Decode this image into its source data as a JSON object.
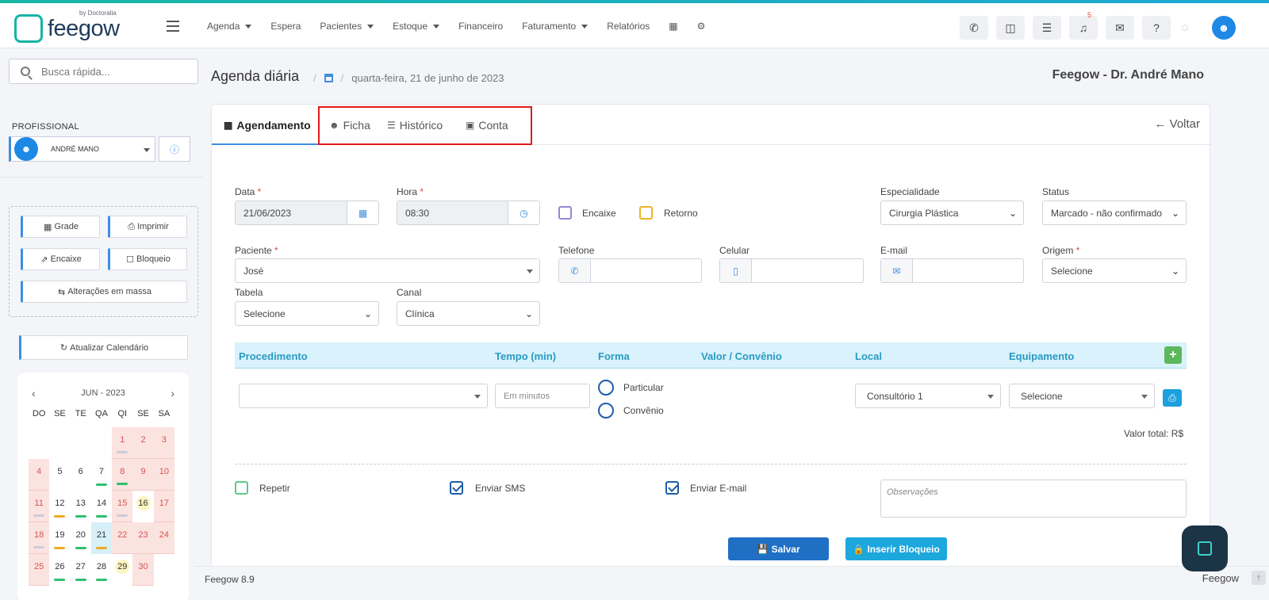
{
  "brand": {
    "name": "feegow",
    "by": "by Doctoralia",
    "accent": "#16b4a5"
  },
  "nav": [
    {
      "label": "Agenda",
      "dropdown": true
    },
    {
      "label": "Espera",
      "dropdown": false
    },
    {
      "label": "Pacientes",
      "dropdown": true
    },
    {
      "label": "Estoque",
      "dropdown": true
    },
    {
      "label": "Financeiro",
      "dropdown": false
    },
    {
      "label": "Faturamento",
      "dropdown": true
    },
    {
      "label": "Relatórios",
      "dropdown": false
    }
  ],
  "topbar": {
    "notifications_count": "5"
  },
  "sidebar": {
    "search_placeholder": "Busca rápida...",
    "profissional_label": "PROFISSIONAL",
    "profissional_name": "ANDRÉ MANO",
    "buttons": {
      "grade": "Grade",
      "imprimir": "Imprimir",
      "encaixe": "Encaixe",
      "bloqueio": "Bloqueio",
      "alteracoes": "Alterações em massa"
    },
    "atualizar": "Atualizar Calendário",
    "calendar": {
      "month": "JUN - 2023",
      "weekdays": [
        "DO",
        "SE",
        "TE",
        "QA",
        "QI",
        "SE",
        "SA"
      ],
      "weeks": [
        [
          "",
          "",
          "",
          "",
          "1",
          "2",
          "3"
        ],
        [
          "4",
          "5",
          "6",
          "7",
          "8",
          "9",
          "10"
        ],
        [
          "11",
          "12",
          "13",
          "14",
          "15",
          "16",
          "17"
        ],
        [
          "18",
          "19",
          "20",
          "21",
          "22",
          "23",
          "24"
        ],
        [
          "25",
          "26",
          "27",
          "28",
          "29",
          "30",
          ""
        ]
      ]
    }
  },
  "page": {
    "title": "Agenda diária",
    "date": "quarta-feira, 21 de junho de 2023",
    "doctor": "Feegow - Dr. André Mano"
  },
  "tabs": {
    "agendamento": "Agendamento",
    "ficha": "Ficha",
    "historico": "Histórico",
    "conta": "Conta",
    "voltar": "Voltar"
  },
  "form": {
    "data_label": "Data",
    "data_value": "21/06/2023",
    "hora_label": "Hora",
    "hora_value": "08:30",
    "encaixe": "Encaixe",
    "retorno": "Retorno",
    "especialidade_label": "Especialidade",
    "especialidade_value": "Cirurgia Plástica",
    "status_label": "Status",
    "status_value": "Marcado - não confirmado",
    "paciente_label": "Paciente",
    "paciente_value": "José",
    "telefone_label": "Telefone",
    "celular_label": "Celular",
    "email_label": "E-mail",
    "origem_label": "Origem",
    "origem_value": "Selecione",
    "tabela_label": "Tabela",
    "tabela_value": "Selecione",
    "canal_label": "Canal",
    "canal_value": "Clínica"
  },
  "procedures": {
    "headers": {
      "procedimento": "Procedimento",
      "tempo": "Tempo (min)",
      "forma": "Forma",
      "valor": "Valor / Convênio",
      "local": "Local",
      "equipamento": "Equipamento"
    },
    "tempo_placeholder": "Em minutos",
    "particular": "Particular",
    "convenio": "Convênio",
    "local_value": "Consultório 1",
    "equipamento_value": "Selecione",
    "valor_total": "Valor total: R$"
  },
  "options": {
    "repetir": "Repetir",
    "enviar_sms": "Enviar SMS",
    "enviar_email": "Enviar E-mail",
    "observacoes_placeholder": "Observações"
  },
  "actions": {
    "salvar": "Salvar",
    "inserir_bloqueio": "Inserir Bloqueio"
  },
  "footer": {
    "version": "Feegow 8.9",
    "brand": "Feegow"
  }
}
